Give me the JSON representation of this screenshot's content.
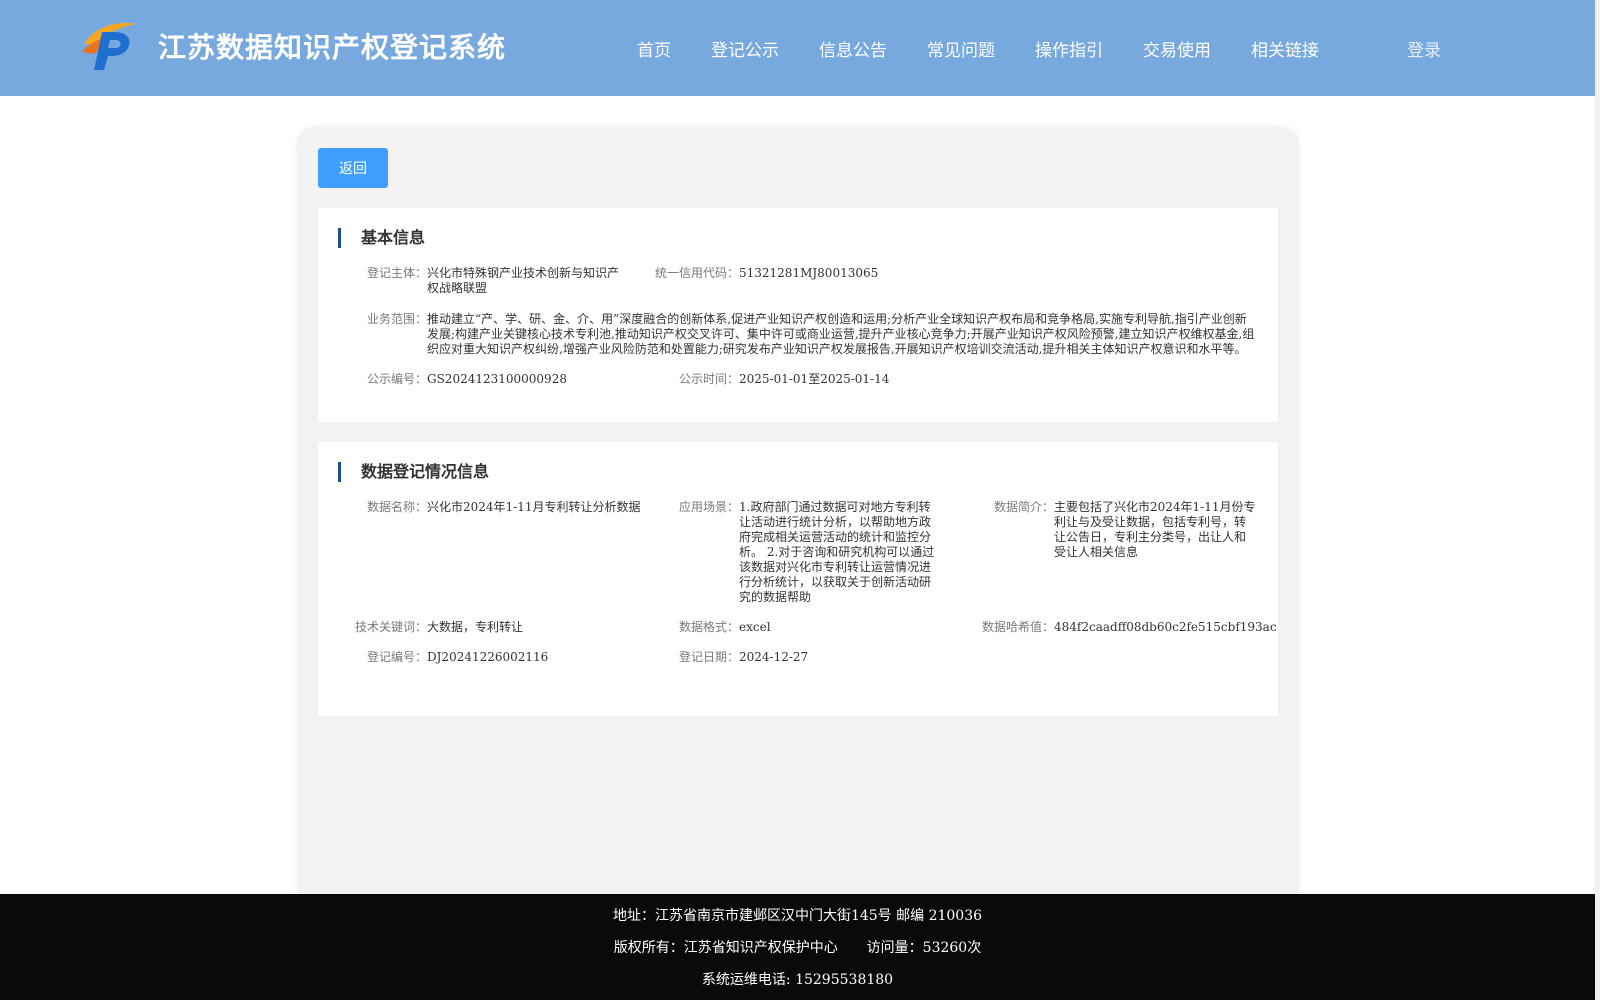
{
  "header": {
    "title": "江苏数据知识产权登记系统",
    "nav": [
      "首页",
      "登记公示",
      "信息公告",
      "常见问题",
      "操作指引",
      "交易使用",
      "相关链接"
    ],
    "login": "登录"
  },
  "back_button": "返回",
  "basic_info": {
    "title": "基本信息",
    "subject_label": "登记主体：",
    "subject_value": "兴化市特殊钢产业技术创新与知识产权战略联盟",
    "credit_label": "统一信用代码：",
    "credit_value": "51321281MJ80013065",
    "scope_label": "业务范围：",
    "scope_value": "推动建立“产、学、研、金、介、用”深度融合的创新体系,促进产业知识产权创造和运用;分析产业全球知识产权布局和竞争格局,实施专利导航,指引产业创新发展;构建产业关键核心技术专利池,推动知识产权交叉许可、集中许可或商业运营,提升产业核心竞争力;开展产业知识产权风险预警,建立知识产权维权基金,组织应对重大知识产权纠纷,增强产业风险防范和处置能力;研究发布产业知识产权发展报告,开展知识产权培训交流活动,提升相关主体知识产权意识和水平等。",
    "pub_no_label": "公示编号：",
    "pub_no_value": "GS2024123100000928",
    "pub_time_label": "公示时间：",
    "pub_time_value": "2025-01-01至2025-01-14"
  },
  "data_info": {
    "title": "数据登记情况信息",
    "name_label": "数据名称：",
    "name_value": "兴化市2024年1-11月专利转让分析数据",
    "scene_label": "应用场景：",
    "scene_value": "1.政府部门通过数据可对地方专利转让活动进行统计分析，以帮助地方政府完成相关运营活动的统计和监控分析。 2.对于咨询和研究机构可以通过该数据对兴化市专利转让运营情况进行分析统计，以获取关于创新活动研究的数据帮助",
    "intro_label": "数据简介：",
    "intro_value": "主要包括了兴化市2024年1-11月份专利让与及受让数据，包括专利号，转让公告日，专利主分类号，出让人和受让人相关信息",
    "keywords_label": "技术关键词：",
    "keywords_value": "大数据，专利转让",
    "format_label": "数据格式：",
    "format_value": "excel",
    "hash_label": "数据哈希值：",
    "hash_value": "484f2caadff08db60c2fe515cbf193ac",
    "reg_no_label": "登记编号：",
    "reg_no_value": "DJ20241226002116",
    "reg_date_label": "登记日期：",
    "reg_date_value": "2024-12-27"
  },
  "footer": {
    "address": "地址：江苏省南京市建邺区汉中门大街145号 邮编 210036",
    "copyright": "版权所有：江苏省知识产权保护中心",
    "visits": "访问量：53260次",
    "phone": "系统运维电话: 15295538180"
  }
}
